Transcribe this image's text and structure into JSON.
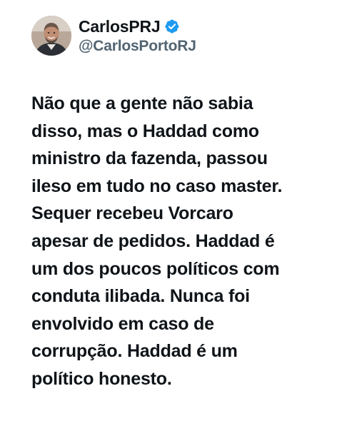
{
  "author": {
    "display_name": "CarlosPRJ",
    "handle": "@CarlosPortoRJ",
    "avatar_icon": "profile-photo",
    "verified": true,
    "verified_icon": "verified-badge-icon"
  },
  "tweet": {
    "lines": [
      "Não que a gente não sabia",
      "disso, mas o Haddad como",
      "ministro da fazenda, passou",
      "ileso em tudo no caso master.",
      "Sequer recebeu Vorcaro",
      "apesar de pedidos. Haddad é",
      "um dos poucos políticos com",
      "conduta ilibada. Nunca foi",
      "envolvido em caso de",
      "corrupção. Haddad é um",
      "político honesto."
    ]
  },
  "colors": {
    "text": "#0f1419",
    "secondary": "#536471",
    "verified_blue": "#1d9bf0",
    "background": "#ffffff"
  }
}
